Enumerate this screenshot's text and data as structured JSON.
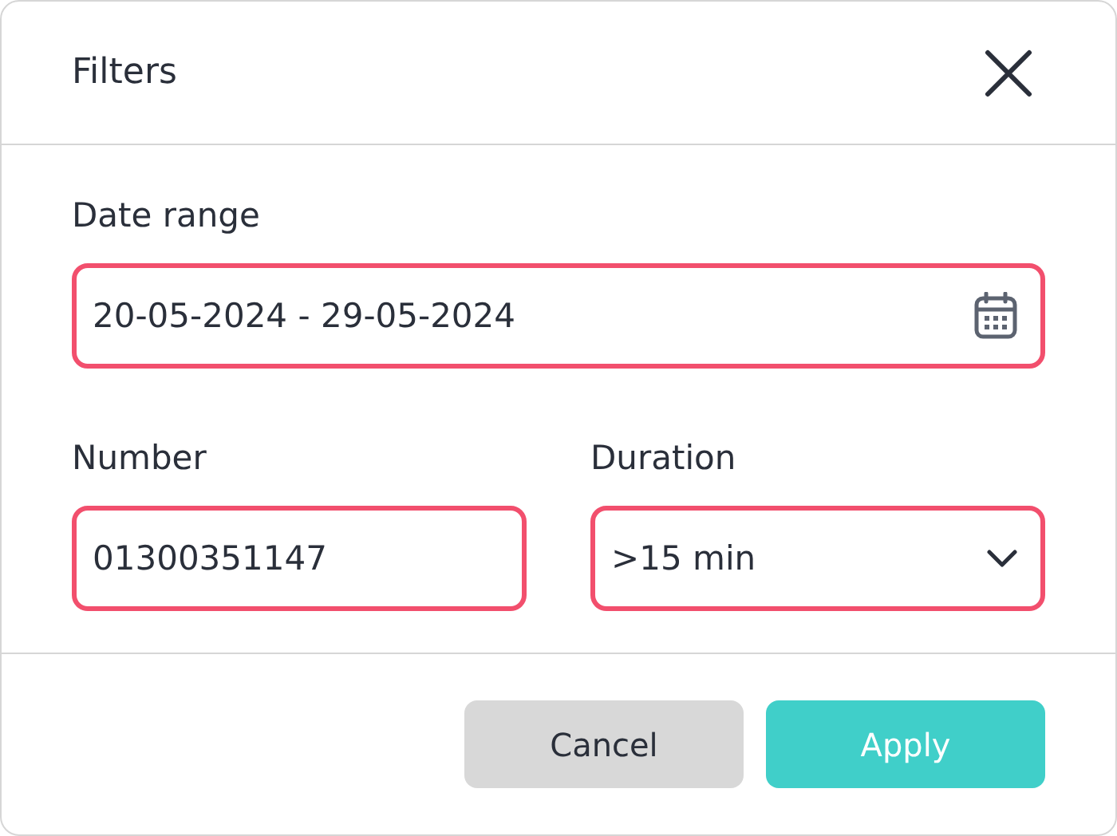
{
  "dialog": {
    "title": "Filters"
  },
  "fields": [
    {
      "label": "Date range",
      "value": "20-05-2024 - 29-05-2024",
      "kind": "date",
      "invalid": true
    },
    {
      "label": "Number",
      "value": "01300351147",
      "kind": "text",
      "invalid": true
    },
    {
      "label": "Duration",
      "value": ">15 min",
      "kind": "select",
      "invalid": true
    }
  ],
  "buttons": [
    {
      "label": "Cancel",
      "kind": "secondary"
    },
    {
      "label": "Apply",
      "kind": "primary"
    }
  ]
}
